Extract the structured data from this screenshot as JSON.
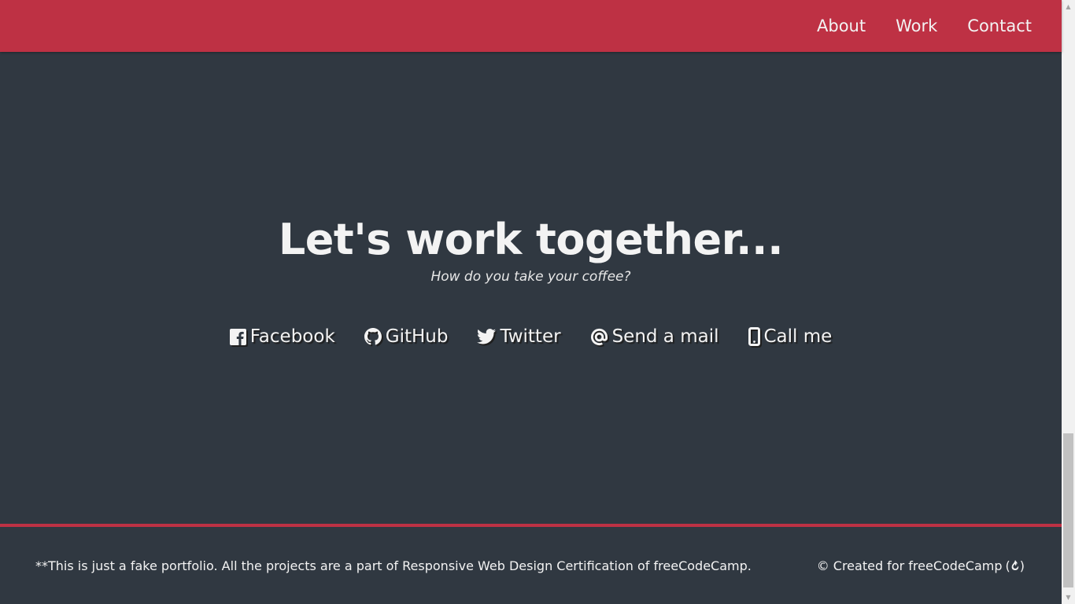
{
  "nav": {
    "items": [
      {
        "label": "About"
      },
      {
        "label": "Work"
      },
      {
        "label": "Contact"
      }
    ]
  },
  "contact": {
    "headline": "Let's work together...",
    "subline": "How do you take your coffee?",
    "links": [
      {
        "label": "Facebook",
        "icon": "facebook-icon"
      },
      {
        "label": "GitHub",
        "icon": "github-icon"
      },
      {
        "label": "Twitter",
        "icon": "twitter-icon"
      },
      {
        "label": "Send a mail",
        "icon": "at-icon"
      },
      {
        "label": "Call me",
        "icon": "mobile-phone-icon"
      }
    ]
  },
  "footer": {
    "disclaimer": "**This is just a fake portfolio. All the projects are a part of Responsive Web Design Certification of freeCodeCamp.",
    "credit_prefix": "© Created for freeCodeCamp",
    "credit_icon": "freecodecamp-fire-icon"
  },
  "colors": {
    "accent": "#be3144",
    "background": "#303841",
    "text": "#f3f3f3"
  }
}
